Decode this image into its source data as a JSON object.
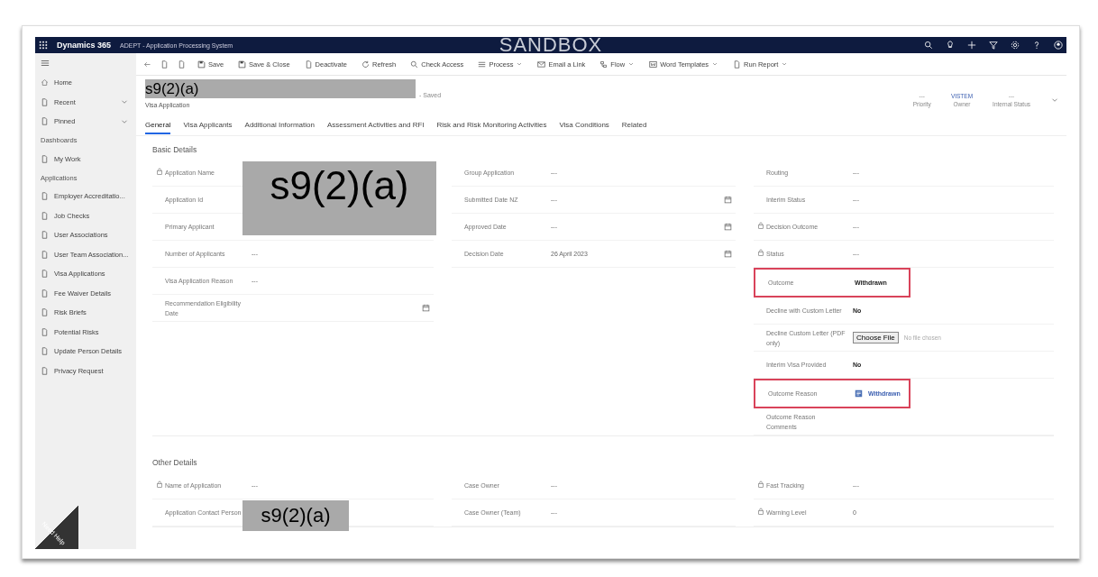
{
  "top_bar": {
    "app": "Dynamics 365",
    "system": "ADEPT - Application Processing System",
    "environment": "SANDBOX"
  },
  "command_bar": [
    {
      "label": "Save",
      "kind": "save",
      "menu": false
    },
    {
      "label": "Save & Close",
      "kind": "save-close",
      "menu": false
    },
    {
      "label": "Deactivate",
      "kind": "doc",
      "menu": false
    },
    {
      "label": "Refresh",
      "kind": "refresh",
      "menu": false
    },
    {
      "label": "Check Access",
      "kind": "search",
      "menu": false
    },
    {
      "label": "Process",
      "kind": "list",
      "menu": true
    },
    {
      "label": "Email a Link",
      "kind": "mail",
      "menu": false
    },
    {
      "label": "Flow",
      "kind": "flow",
      "menu": true
    },
    {
      "label": "Word Templates",
      "kind": "word",
      "menu": true
    },
    {
      "label": "Run Report",
      "kind": "report",
      "menu": true
    }
  ],
  "sidebar": {
    "items": [
      {
        "label": "Home",
        "kind": "item",
        "chevron": false
      },
      {
        "label": "Recent",
        "kind": "item",
        "chevron": true
      },
      {
        "label": "Pinned",
        "kind": "item",
        "chevron": true
      },
      {
        "label": "Dashboards",
        "kind": "header",
        "chevron": false
      },
      {
        "label": "My Work",
        "kind": "item",
        "chevron": false
      },
      {
        "label": "Applications",
        "kind": "header",
        "chevron": false
      },
      {
        "label": "Employer Accreditatio...",
        "kind": "item",
        "chevron": false
      },
      {
        "label": "Job Checks",
        "kind": "item",
        "chevron": false
      },
      {
        "label": "User Associations",
        "kind": "item",
        "chevron": false
      },
      {
        "label": "User Team Association...",
        "kind": "item",
        "chevron": false
      },
      {
        "label": "Visa Applications",
        "kind": "item",
        "chevron": false
      },
      {
        "label": "Fee Waiver Details",
        "kind": "item",
        "chevron": false
      },
      {
        "label": "Risk Briefs",
        "kind": "item",
        "chevron": false
      },
      {
        "label": "Potential Risks",
        "kind": "item",
        "chevron": false
      },
      {
        "label": "Update Person Details",
        "kind": "item",
        "chevron": false
      },
      {
        "label": "Privacy Request",
        "kind": "item",
        "chevron": false
      }
    ],
    "help": "Need Help"
  },
  "record": {
    "title_redaction": "s9(2)(a)",
    "save_state": "- Saved",
    "entity": "Visa Application",
    "header_fields": [
      {
        "value": "---",
        "label": "Priority",
        "link": false
      },
      {
        "value": "VISTEM",
        "label": "Owner",
        "link": true
      },
      {
        "value": "---",
        "label": "Internal Status",
        "link": false
      }
    ]
  },
  "tabs": [
    {
      "label": "General",
      "selected": true
    },
    {
      "label": "Visa Applicants",
      "selected": false
    },
    {
      "label": "Additional Information",
      "selected": false
    },
    {
      "label": "Assessment Activities and RFI",
      "selected": false
    },
    {
      "label": "Risk and Risk Monitoring Activities",
      "selected": false
    },
    {
      "label": "Visa Conditions",
      "selected": false
    },
    {
      "label": "Related",
      "selected": false
    }
  ],
  "sections": [
    {
      "title": "Basic Details",
      "redaction": "s9(2)(a)",
      "columns": [
        [
          {
            "label": "Application Name",
            "kind": "hidden",
            "locked": true,
            "highlighted": false
          },
          {
            "label": "Application Id",
            "kind": "hidden",
            "locked": false,
            "highlighted": false
          },
          {
            "label": "Primary Applicant",
            "kind": "hidden",
            "locked": false,
            "highlighted": false
          },
          {
            "label": "Number of Applicants",
            "kind": "text",
            "value": "---",
            "locked": false,
            "highlighted": false
          },
          {
            "label": "Visa Application Reason",
            "kind": "text",
            "value": "---",
            "locked": false,
            "highlighted": false
          },
          {
            "label": "Recommendation Eligibility Date",
            "kind": "date",
            "locked": false,
            "highlighted": false
          }
        ],
        [
          {
            "label": "Group Application",
            "kind": "text",
            "value": "---",
            "locked": false,
            "highlighted": false
          },
          {
            "label": "Submitted Date NZ",
            "kind": "date",
            "value": "---",
            "locked": false,
            "highlighted": false
          },
          {
            "label": "Approved Date",
            "kind": "date",
            "value": "---",
            "locked": false,
            "highlighted": false
          },
          {
            "label": "Decision Date",
            "kind": "date",
            "value": "26 April 2023",
            "locked": false,
            "highlighted": false
          }
        ],
        [
          {
            "label": "Routing",
            "kind": "text",
            "value": "---",
            "locked": false,
            "highlighted": false
          },
          {
            "label": "Interim Status",
            "kind": "text",
            "value": "---",
            "locked": false,
            "highlighted": false
          },
          {
            "label": "Decision Outcome",
            "kind": "text",
            "value": "---",
            "locked": true,
            "highlighted": false
          },
          {
            "label": "Status",
            "kind": "text",
            "value": "---",
            "locked": true,
            "highlighted": false
          },
          {
            "label": "Outcome",
            "kind": "choice",
            "value": "Withdrawn",
            "locked": false,
            "highlighted": true
          },
          {
            "label": "Decline with Custom Letter",
            "kind": "choice",
            "value": "No",
            "locked": false,
            "highlighted": false
          },
          {
            "label": "Decline Custom Letter (PDF only)",
            "kind": "file",
            "value": "Choose File",
            "note": "No file chosen",
            "locked": false,
            "highlighted": false
          },
          {
            "label": "Interim Visa Provided",
            "kind": "choice",
            "value": "No",
            "locked": false,
            "highlighted": false
          },
          {
            "label": "Outcome Reason",
            "kind": "lookup",
            "value": "Withdrawn",
            "locked": false,
            "highlighted": true
          },
          {
            "label": "Outcome Reason Comments",
            "kind": "text",
            "locked": false,
            "highlighted": false
          }
        ]
      ]
    },
    {
      "title": "Other Details",
      "redaction": "s9(2)(a)",
      "columns": [
        [
          {
            "label": "Name of Application",
            "kind": "text",
            "value": "---",
            "locked": true,
            "highlighted": false
          },
          {
            "label": "Application Contact Person",
            "kind": "hidden",
            "locked": false,
            "highlighted": false
          }
        ],
        [
          {
            "label": "Case Owner",
            "kind": "text",
            "value": "---",
            "locked": false,
            "highlighted": false
          },
          {
            "label": "Case Owner (Team)",
            "kind": "text",
            "value": "---",
            "locked": false,
            "highlighted": false
          }
        ],
        [
          {
            "label": "Fast Tracking",
            "kind": "text",
            "value": "---",
            "locked": true,
            "highlighted": false
          },
          {
            "label": "Warning Level",
            "kind": "text",
            "value": "0",
            "locked": true,
            "highlighted": false
          }
        ]
      ]
    }
  ]
}
